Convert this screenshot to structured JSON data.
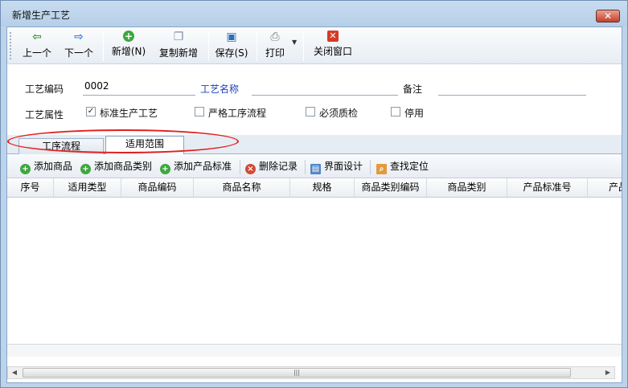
{
  "window": {
    "title": "新增生产工艺",
    "close_glyph": "✕"
  },
  "toolbar": {
    "prev_label": "上一个",
    "next_label": "下一个",
    "new_label": "新增(N)",
    "copy_new_label": "复制新增",
    "save_label": "保存(S)",
    "print_label": "打印",
    "close_label": "关闭窗口"
  },
  "form": {
    "code_label": "工艺编码",
    "code_value": "0002",
    "name_label": "工艺名称",
    "name_value": "",
    "remark_label": "备注",
    "remark_value": "",
    "attr_label": "工艺属性",
    "checkboxes": [
      {
        "label": "标准生产工艺",
        "checked": true
      },
      {
        "label": "严格工序流程",
        "checked": false
      },
      {
        "label": "必须质检",
        "checked": false
      },
      {
        "label": "停用",
        "checked": false
      }
    ]
  },
  "tabs": [
    {
      "label": "工序流程",
      "active": false
    },
    {
      "label": "适用范围",
      "active": true
    }
  ],
  "subtoolbar": {
    "add_product": "添加商品",
    "add_category": "添加商品类别",
    "add_standard": "添加产品标准",
    "delete_record": "删除记录",
    "layout_design": "界面设计",
    "find_locate": "查找定位"
  },
  "grid": {
    "columns": [
      "序号",
      "适用类型",
      "商品编码",
      "商品名称",
      "规格",
      "商品类别编码",
      "商品类别",
      "产品标准号",
      "产品"
    ],
    "rows": []
  },
  "colors": {
    "highlight": "#e02020",
    "link": "#1a3fbf"
  }
}
